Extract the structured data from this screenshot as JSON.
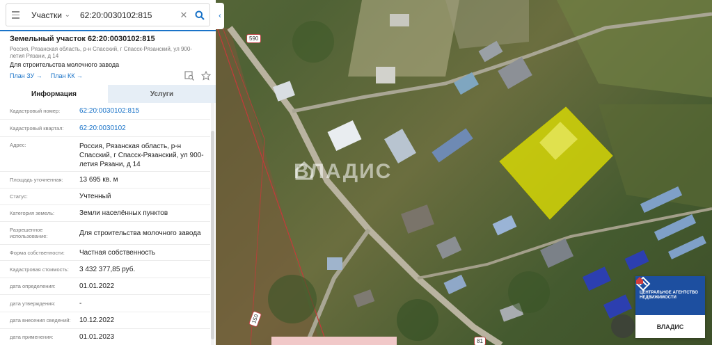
{
  "search": {
    "scope": "Участки",
    "value": "62:20:0030102:815"
  },
  "parcel": {
    "title": "Земельный участок 62:20:0030102:815",
    "address": "Россия, Рязанская область, р-н Спасский, г Спасск-Рязанский, ул 900-летия Рязани, д 14",
    "purpose": "Для строительства молочного завода",
    "links": [
      "План ЗУ →",
      "План КК →"
    ]
  },
  "tabs": [
    "Информация",
    "Услуги"
  ],
  "properties": [
    {
      "label": "Кадастровый номер:",
      "value": "62:20:0030102:815",
      "link": true
    },
    {
      "label": "Кадастровый квартал:",
      "value": "62:20:0030102",
      "link": true
    },
    {
      "label": "Адрес:",
      "value": "Россия, Рязанская область, р-н Спасский, г Спасск-Рязанский, ул 900-летия Рязани, д 14",
      "link": false
    },
    {
      "label": "Площадь уточненная:",
      "value": "13 695 кв. м",
      "link": false
    },
    {
      "label": "Статус:",
      "value": "Учтенный",
      "link": false
    },
    {
      "label": "Категория земель:",
      "value": "Земли населённых пунктов",
      "link": false
    },
    {
      "label": "Разрешенное использование:",
      "value": "Для строительства молочного завода",
      "link": false
    },
    {
      "label": "Форма собственности:",
      "value": "Частная собственность",
      "link": false
    },
    {
      "label": "Кадастровая стоимость:",
      "value": "3 432 377,85 руб.",
      "link": false
    },
    {
      "label": "дата определения:",
      "value": "01.01.2022",
      "link": false
    },
    {
      "label": "дата утверждения:",
      "value": "-",
      "link": false
    },
    {
      "label": "дата внесения сведений:",
      "value": "10.12.2022",
      "link": false
    },
    {
      "label": "дата применения:",
      "value": "01.01.2023",
      "link": false
    }
  ],
  "map": {
    "watermark": "ВЛАДИС",
    "road_labels": [
      "590",
      "150",
      "81"
    ],
    "parcel_color": "#e6e600"
  },
  "logo": {
    "agency": "ЦЕНТРАЛЬНОЕ АГЕНТСТВО НЕДВИЖИМОСТИ",
    "brand": "ВЛАДИС"
  },
  "colors": {
    "accent": "#1a73c8",
    "logo_blue": "#1d4fa0"
  }
}
